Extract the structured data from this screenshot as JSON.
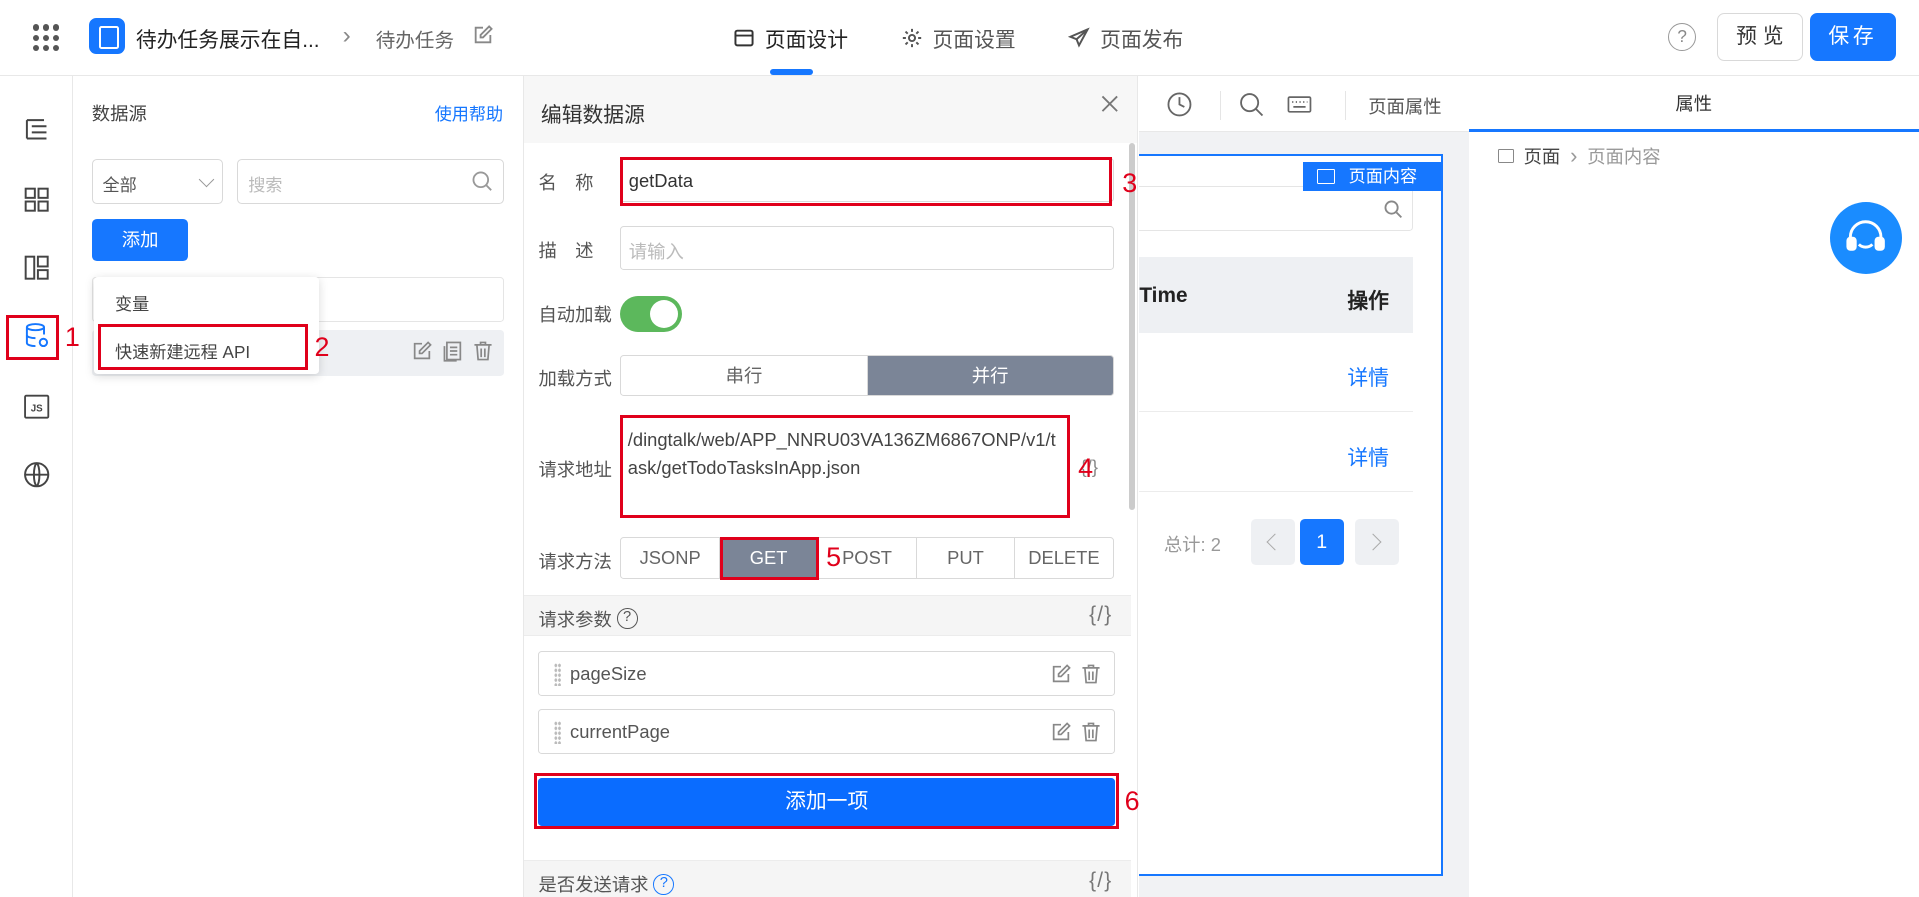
{
  "header": {
    "app_title": "待办任务展示在自...",
    "page_name": "待办任务",
    "tabs": [
      {
        "label": "页面设计",
        "icon": "layout-icon"
      },
      {
        "label": "页面设置",
        "icon": "gear-icon"
      },
      {
        "label": "页面发布",
        "icon": "send-icon"
      }
    ],
    "active_tab": "页面设计",
    "help_glyph": "?",
    "preview_label": "预 览",
    "save_label": "保存"
  },
  "rail": {
    "items": [
      {
        "icon": "outline-tree-icon"
      },
      {
        "icon": "components-grid-icon"
      },
      {
        "icon": "layout-template-icon"
      },
      {
        "icon": "datasource-icon",
        "active": true
      },
      {
        "icon": "js-icon",
        "text": "JS"
      },
      {
        "icon": "globe-icon"
      }
    ]
  },
  "datasource_panel": {
    "title": "数据源",
    "help_link": "使用帮助",
    "filter_value": "全部",
    "search_placeholder": "搜索",
    "add_label": "添加",
    "dropdown": [
      "变量",
      "快速新建远程 API"
    ]
  },
  "edit_panel": {
    "title": "编辑数据源",
    "name_label": "名　称",
    "name_value": "getData",
    "desc_label": "描　述",
    "desc_placeholder": "请输入",
    "autoload_label": "自动加载",
    "autoload_on": true,
    "load_mode_label": "加载方式",
    "load_modes": [
      "串行",
      "并行"
    ],
    "load_mode_selected": "并行",
    "url_label": "请求地址",
    "url_value": "/dingtalk/web/APP_NNRU03VA136ZM6867ONP/v1/task/getTodoTasksInApp.json",
    "var_glyph": "{/}",
    "method_label": "请求方法",
    "methods": [
      "JSONP",
      "GET",
      "POST",
      "PUT",
      "DELETE"
    ],
    "method_selected": "GET",
    "params_label": "请求参数",
    "params": [
      "pageSize",
      "currentPage"
    ],
    "add_item_label": "添加一项",
    "send_label": "是否发送请求"
  },
  "canvas": {
    "property_label": "页面属性",
    "frame_tag": "页面内容",
    "table_headers": [
      "Time",
      "操作"
    ],
    "row_links": [
      "详情",
      "详情"
    ],
    "total_text": "总计: 2",
    "current_page": "1"
  },
  "properties": {
    "title": "属性",
    "crumb": [
      "页面",
      "页面内容"
    ]
  },
  "annotations": [
    "1",
    "2",
    "3",
    "4",
    "5",
    "6"
  ],
  "colors": {
    "accent": "#1677ff",
    "annotation_red": "#e0001b",
    "toggle_green": "#5cb85c",
    "segment_selected": "#7b8597"
  }
}
